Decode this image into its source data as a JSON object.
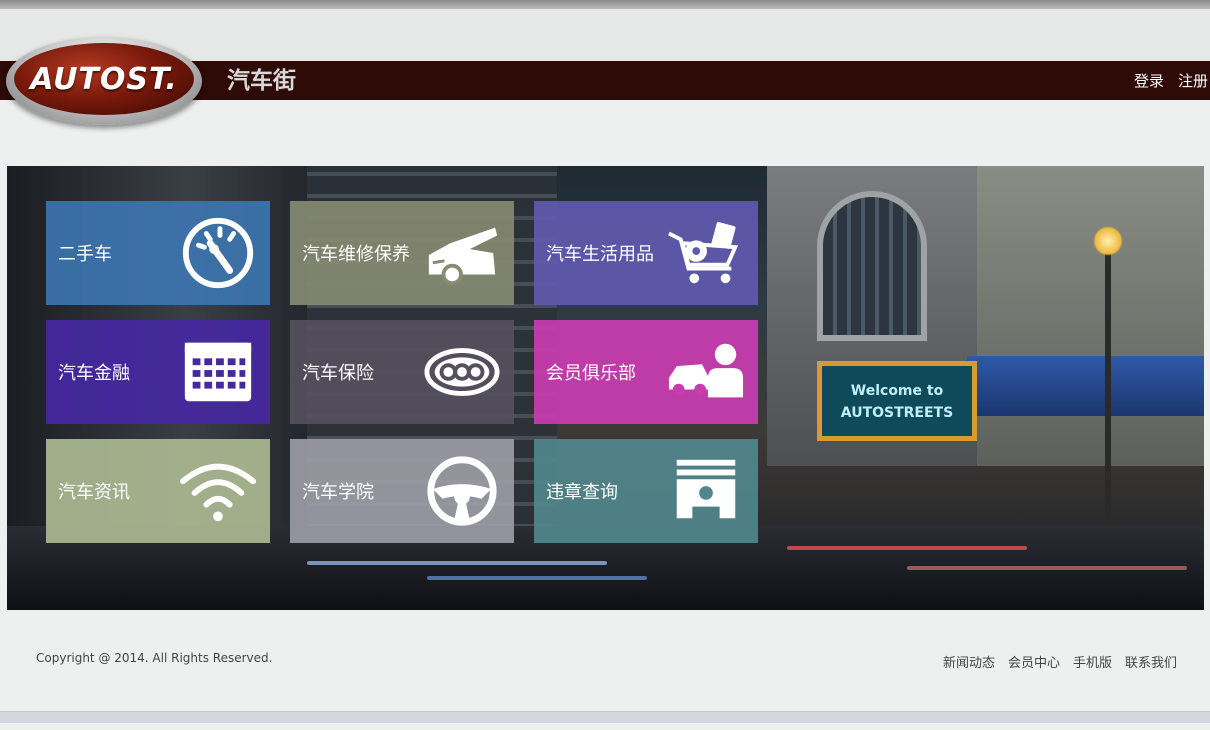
{
  "header": {
    "logo_text": "AUTOST.",
    "site_title": "汽车街",
    "links": [
      {
        "label": "登录"
      },
      {
        "label": "注册"
      }
    ],
    "bar_color": "#2e0b06"
  },
  "banner": {
    "marquee_line1": "Welcome to",
    "marquee_line2": "AUTOSTREETS"
  },
  "tiles": [
    {
      "label": "二手车",
      "icon": "speedometer-icon",
      "color": "#3c78b4"
    },
    {
      "label": "汽车维修保养",
      "icon": "car-hood-icon",
      "color": "#878c73"
    },
    {
      "label": "汽车生活用品",
      "icon": "shopping-cart-icon",
      "color": "#5f5aaf"
    },
    {
      "label": "汽车金融",
      "icon": "calendar-icon",
      "color": "#4628a0"
    },
    {
      "label": "汽车保险",
      "icon": "cd-icon",
      "color": "#55505f"
    },
    {
      "label": "会员俱乐部",
      "icon": "car-person-icon",
      "color": "#c83caf"
    },
    {
      "label": "汽车资讯",
      "icon": "wifi-icon",
      "color": "#aab991"
    },
    {
      "label": "汽车学院",
      "icon": "steering-wheel-icon",
      "color": "#a0a0aa"
    },
    {
      "label": "违章查询",
      "icon": "piston-icon",
      "color": "#50878c"
    }
  ],
  "footer": {
    "copyright": "Copyright @ 2014. All Rights Reserved.",
    "links": [
      {
        "label": "新闻动态"
      },
      {
        "label": "会员中心"
      },
      {
        "label": "手机版"
      },
      {
        "label": "联系我们"
      }
    ]
  }
}
